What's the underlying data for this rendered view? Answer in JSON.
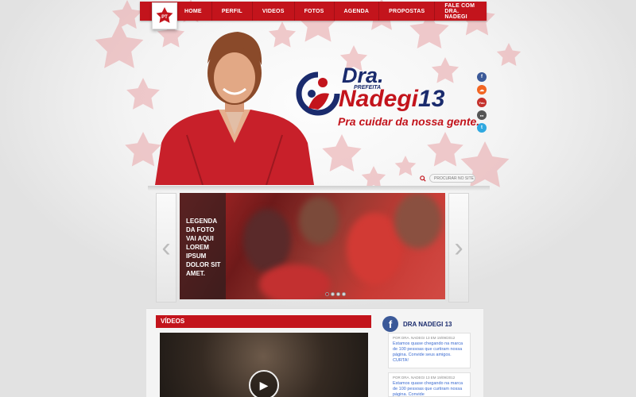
{
  "nav": {
    "items": [
      {
        "label": "HOME",
        "active": true
      },
      {
        "label": "PERFIL",
        "active": false
      },
      {
        "label": "VIDEOS",
        "active": false
      },
      {
        "label": "FOTOS",
        "active": false
      },
      {
        "label": "AGENDA",
        "active": false
      },
      {
        "label": "PROPOSTAS",
        "active": false
      },
      {
        "label": "FALE COM DRA. NADEGI",
        "active": false
      }
    ]
  },
  "party_badge": {
    "label": "PT"
  },
  "brand": {
    "dra": "Dra.",
    "prefeita": "PREFEITA",
    "name": "Nadegi",
    "number": "13",
    "slogan": "Pra cuidar da nossa gente."
  },
  "social": [
    {
      "icon": "facebook-icon",
      "glyph": "f",
      "color": "#3b5998"
    },
    {
      "icon": "soundcloud-icon",
      "glyph": "☁",
      "color": "#f26522"
    },
    {
      "icon": "youtube-icon",
      "glyph": "You",
      "color": "#c4302b"
    },
    {
      "icon": "flickr-icon",
      "glyph": "●●",
      "color": "#555555"
    },
    {
      "icon": "twitter-icon",
      "glyph": "t",
      "color": "#2fa8e0"
    }
  ],
  "search": {
    "placeholder": "PROCURAR NO SITE"
  },
  "slider": {
    "caption": "LEGENDA DA FOTO VAI AQUI LOREM IPSUM DOLOR SIT AMET.",
    "dots": 4,
    "active_dot": 0
  },
  "videos": {
    "title": "VÍDEOS"
  },
  "facebook": {
    "title": "DRA NADEGI 13",
    "posts": [
      {
        "meta": "POR DRA. NADEGI 13 EM 19/09/2012",
        "body": "Estamos quase chegando na marca de 100 pessoas que curtiram nossa página. Convide seus amigos. CURTA!"
      },
      {
        "meta": "POR DRA. NADEGI 13 EM 19/09/2012",
        "body": "Estamos quase chegando na marca de 100 pessoas que curtiram nossa página. Convide"
      }
    ]
  }
}
